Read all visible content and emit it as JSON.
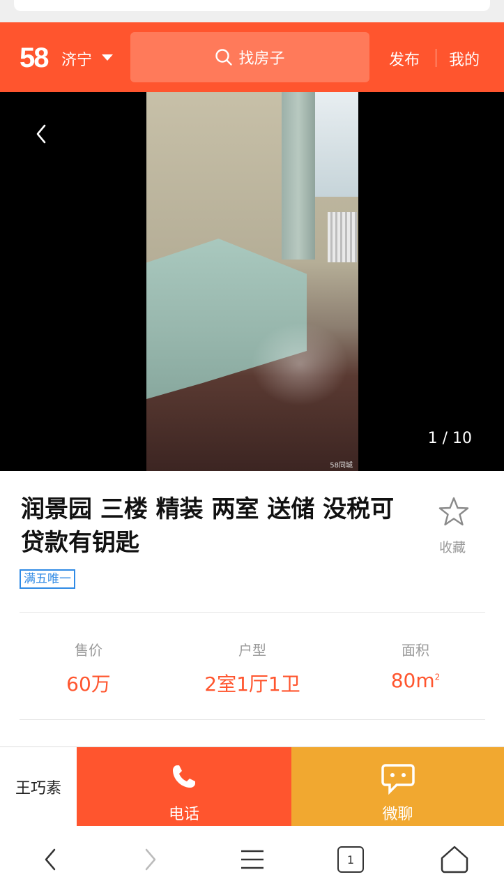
{
  "header": {
    "logo": "58",
    "city": "济宁",
    "search_placeholder": "找房子",
    "publish_label": "发布",
    "mine_label": "我的"
  },
  "gallery": {
    "counter": "1 / 10",
    "watermark": "58同城"
  },
  "listing": {
    "title": "润景园 三楼 精装 两室 送储 没税可贷款有钥匙",
    "favorite_label": "收藏",
    "tag": "满五唯一"
  },
  "stats": {
    "price_label": "售价",
    "price_value": "60万",
    "layout_label": "户型",
    "layout_value": "2室1厅1卫",
    "area_label": "面积",
    "area_value": "80m",
    "area_unit_sup": "2"
  },
  "contact": {
    "agent_name": "王巧素",
    "call_label": "电话",
    "chat_label": "微聊"
  },
  "colors": {
    "brand": "#ff552e",
    "chat": "#f1a830",
    "tag": "#2f8ae5"
  },
  "icons": {
    "search": "search-icon",
    "back": "back-arrow-icon",
    "star": "star-icon",
    "phone": "phone-icon",
    "chat": "chat-icon",
    "nav_back": "nav-back-icon",
    "nav_forward": "nav-forward-icon",
    "nav_menu": "menu-icon",
    "nav_tabs": "tabs-icon",
    "nav_home": "home-icon"
  },
  "navbar": {
    "tab_count": "1"
  }
}
